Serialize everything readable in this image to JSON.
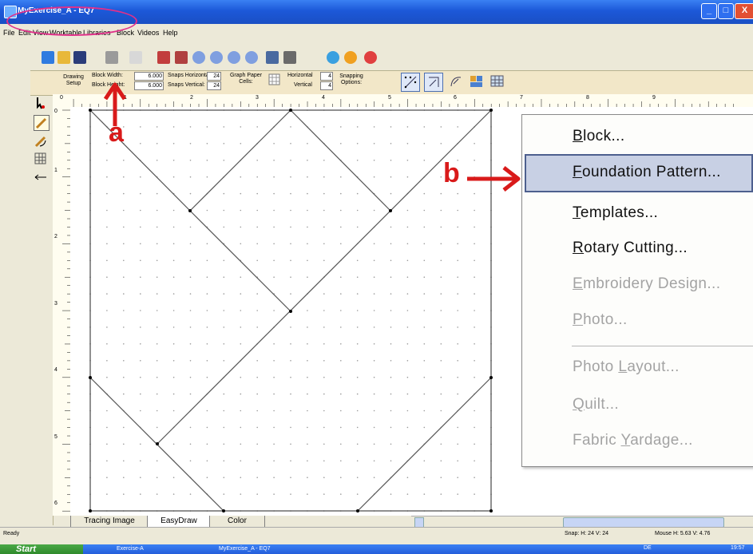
{
  "window": {
    "title": "MyExercise_A - EQ7",
    "controls": {
      "minimize": "_",
      "maximize": "□",
      "close": "X"
    }
  },
  "menubar": {
    "items": [
      "File",
      "Edit",
      "View",
      "Worktable",
      "Libraries",
      "Block",
      "Videos",
      "Help"
    ]
  },
  "toolbar": {
    "icons": [
      "new-icon",
      "open-icon",
      "save-icon",
      "print-icon",
      "undo-icon",
      "add-to-sketchbook-icon",
      "view-sketchbook-icon",
      "zoom-in-icon",
      "zoom-out-icon",
      "refresh-icon",
      "fit-icon",
      "block-library-icon",
      "help-icon",
      "easydraw-icon",
      "pieced-icon",
      "applique-icon"
    ]
  },
  "propbar": {
    "drawing_setup": "Drawing Setup",
    "block_width_label": "Block Width:",
    "block_width_value": "6.000",
    "block_height_label": "Block Height:",
    "block_height_value": "6.000",
    "snaps_horizontal_label": "Snaps Horizontal:",
    "snaps_horizontal_value": "24",
    "snaps_vertical_label": "Snaps Vertical:",
    "snaps_vertical_value": "24",
    "graph_paper_label": "Graph Paper Cells:",
    "horizontal_label": "Horizontal",
    "horizontal_value": "4",
    "vertical_label": "Vertical",
    "vertical_value": "4",
    "snapping_options_label": "Snapping Options:"
  },
  "ruler": {
    "top_numbers": [
      "0",
      "1",
      "2",
      "3",
      "4",
      "5",
      "6",
      "7",
      "8",
      "9"
    ],
    "left_numbers": [
      "0",
      "1",
      "2",
      "3",
      "4",
      "5",
      "6"
    ]
  },
  "tabs": [
    "Tracing Image",
    "EasyDraw",
    "Color"
  ],
  "status": {
    "ready": "Ready",
    "snap": "Snap:  H: 24  V: 24",
    "mouse": "Mouse  H: 5.63  V: 4.76"
  },
  "taskbar": {
    "start": "Start",
    "items": [
      "Exercise-A",
      "MyExercise_A - EQ7"
    ],
    "lang": "DE",
    "clock": "19:57"
  },
  "context_menu": {
    "items": [
      {
        "pre": "",
        "u": "B",
        "post": "lock...",
        "enabled": true
      },
      {
        "pre": "",
        "u": "F",
        "post": "oundation Pattern...",
        "enabled": true,
        "highlighted": true
      },
      {
        "pre": "",
        "u": "T",
        "post": "emplates...",
        "enabled": true
      },
      {
        "pre": "",
        "u": "R",
        "post": "otary Cutting...",
        "enabled": true
      },
      {
        "pre": "",
        "u": "E",
        "post": "mbroidery Design...",
        "enabled": false
      },
      {
        "pre": "",
        "u": "P",
        "post": "hoto...",
        "enabled": false
      },
      {
        "pre": "Photo ",
        "u": "L",
        "post": "ayout...",
        "enabled": false
      },
      {
        "pre": "",
        "u": "Q",
        "post": "uilt...",
        "enabled": false
      },
      {
        "pre": "Fabric ",
        "u": "Y",
        "post": "ardage...",
        "enabled": false
      }
    ]
  },
  "annotations": {
    "a": "a",
    "b": "b",
    "color": "#d91a1a",
    "oval_color": "#e0308a"
  }
}
